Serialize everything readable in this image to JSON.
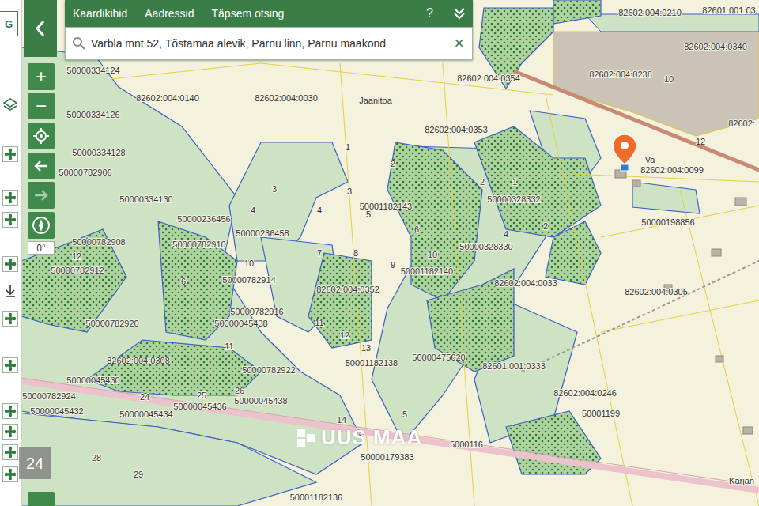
{
  "sidebar": {
    "letter": "G"
  },
  "header": {
    "tabs": [
      {
        "label": "Kaardikihid"
      },
      {
        "label": "Aadressid"
      },
      {
        "label": "Täpsem otsing"
      }
    ],
    "help": "?"
  },
  "search": {
    "value": "Varbla mnt 52, Tõstamaa alevik, Pärnu linn, Pärnu maakond",
    "clear": "×"
  },
  "toolbar": {
    "zoom_in": "+",
    "zoom_out": "−",
    "forward_disabled": true,
    "rotation": "0°",
    "scale_badge": "24"
  },
  "map": {
    "watermark": "UUS MAA",
    "labels": [
      "82602:004:0210",
      "82601:001:03",
      "82602:004:0340",
      "82602:004:0238",
      "10",
      "82602:",
      "12",
      "Va",
      "82602:004:0099",
      "50000334124",
      "50000334126",
      "50000334128",
      "50000782906",
      "50000334130",
      "50000236456",
      "50000236458",
      "50000782908",
      "50000782910",
      "50000782912",
      "50000782914",
      "82602:004:0140",
      "82602:004:0030",
      "82602:004:0354",
      "Jaanitoa",
      "82602:004:0353",
      "50000328332",
      "50000328330",
      "50001182143",
      "50001182140",
      "82602:004:0352",
      "82602:004:0033",
      "50000198856",
      "82602:004:0305",
      "50000782920",
      "50000782916",
      "50000045438",
      "82602:004:0308",
      "50000782922",
      "50001182138",
      "50000475620",
      "82601:001:0333",
      "82602:004:0246",
      "50000045432",
      "50000045434",
      "50000045436",
      "50000045438",
      "50000782924",
      "50000045430",
      "50001199",
      "5000116",
      "50000179383",
      "Karjan",
      "50001182136",
      "1",
      "2",
      "3",
      "4",
      "5",
      "6",
      "7",
      "8",
      "9",
      "10",
      "11",
      "12",
      "13",
      "14",
      "5",
      "2",
      "1",
      "4",
      "3",
      "12",
      "24",
      "25",
      "26",
      "28",
      "29",
      "10",
      "6",
      "11",
      "2",
      "4"
    ]
  }
}
